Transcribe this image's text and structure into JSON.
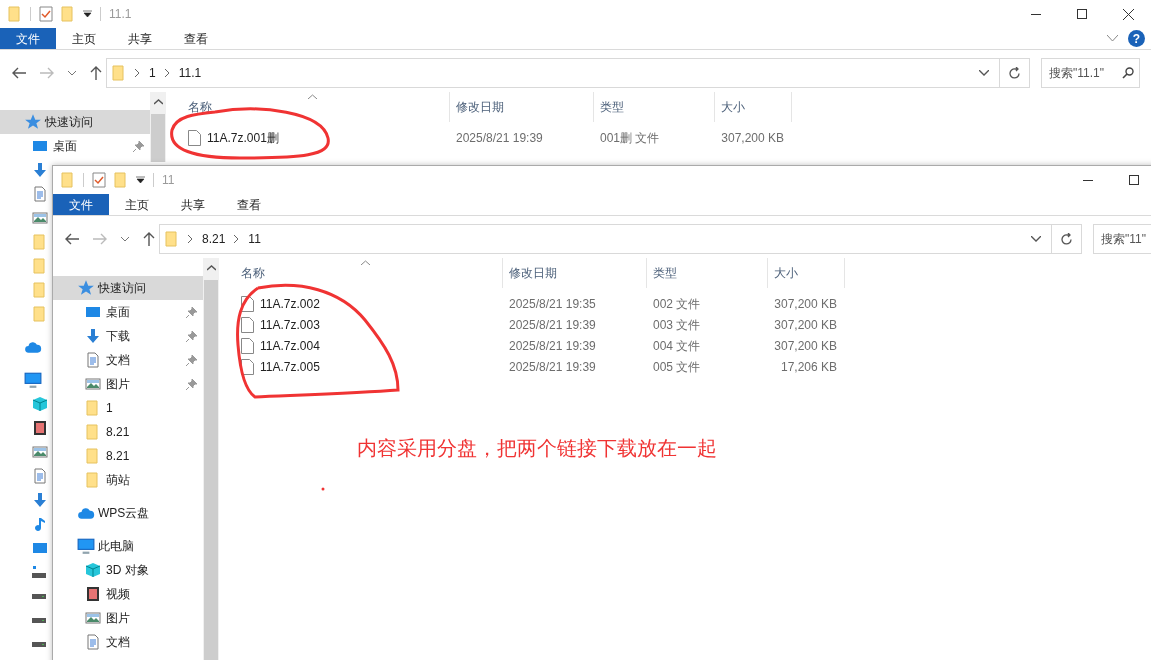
{
  "back_window": {
    "title": "11.1",
    "window_controls": [
      {
        "kind": "minimize"
      },
      {
        "kind": "maximize"
      },
      {
        "kind": "close"
      }
    ],
    "ribbon_tabs": [
      {
        "label": "文件",
        "selected": true
      },
      {
        "label": "主页",
        "selected": false
      },
      {
        "label": "共享",
        "selected": false
      },
      {
        "label": "查看",
        "selected": false
      }
    ],
    "help_button": "?",
    "path": [
      "1",
      "11.1"
    ],
    "search": {
      "placeholder": "搜索\"11.1\""
    },
    "columns": [
      "名称",
      "修改日期",
      "类型",
      "大小"
    ],
    "sidebar": [
      {
        "kind": "star",
        "label": "快速访问",
        "selected": true,
        "children": [
          {
            "kind": "desktop",
            "label": "桌面",
            "pinned": true,
            "selected": false
          },
          {
            "kind": "download",
            "selected": false
          },
          {
            "kind": "document",
            "selected": false
          },
          {
            "kind": "picture",
            "selected": false
          },
          {
            "kind": "folder",
            "selected": false
          },
          {
            "kind": "folder",
            "selected": false
          },
          {
            "kind": "folder",
            "selected": false
          },
          {
            "kind": "folder",
            "selected": false
          }
        ]
      },
      {
        "kind": "cloud",
        "selected": false
      },
      {
        "kind": "computer",
        "selected": false,
        "children": [
          {
            "kind": "cube",
            "selected": false
          },
          {
            "kind": "film",
            "selected": false
          },
          {
            "kind": "picture",
            "selected": false
          },
          {
            "kind": "document",
            "selected": false
          },
          {
            "kind": "download",
            "selected": false
          },
          {
            "kind": "music",
            "selected": false
          },
          {
            "kind": "desktop",
            "selected": false
          },
          {
            "kind": "netdrive",
            "selected": false
          },
          {
            "kind": "drive",
            "selected": false
          },
          {
            "kind": "drive",
            "selected": false
          },
          {
            "kind": "drive",
            "selected": false
          }
        ]
      }
    ],
    "files": [
      {
        "name": "11A.7z.001删",
        "modified": "2025/8/21 19:39",
        "type": "001删 文件",
        "size": "307,200 KB"
      }
    ]
  },
  "front_window": {
    "title": "11",
    "window_controls": [
      {
        "kind": "minimize"
      },
      {
        "kind": "maximize"
      }
    ],
    "ribbon_tabs": [
      {
        "label": "文件",
        "selected": true
      },
      {
        "label": "主页",
        "selected": false
      },
      {
        "label": "共享",
        "selected": false
      },
      {
        "label": "查看",
        "selected": false
      }
    ],
    "path": [
      "8.21",
      "11"
    ],
    "search": {
      "placeholder": "搜索\"11\""
    },
    "columns": [
      "名称",
      "修改日期",
      "类型",
      "大小"
    ],
    "sidebar": [
      {
        "kind": "star",
        "label": "快速访问",
        "selected": true,
        "children": [
          {
            "kind": "desktop",
            "label": "桌面",
            "pinned": true,
            "selected": false
          },
          {
            "kind": "download",
            "label": "下载",
            "pinned": true,
            "selected": false
          },
          {
            "kind": "document",
            "label": "文档",
            "pinned": true,
            "selected": false
          },
          {
            "kind": "picture",
            "label": "图片",
            "pinned": true,
            "selected": false
          },
          {
            "kind": "folder",
            "label": "1",
            "pinned": false,
            "selected": false
          },
          {
            "kind": "folder",
            "label": "8.21",
            "pinned": false,
            "selected": false
          },
          {
            "kind": "folder",
            "label": "8.21",
            "pinned": false,
            "selected": false
          },
          {
            "kind": "folder",
            "label": "萌站",
            "pinned": false,
            "selected": false
          }
        ]
      },
      {
        "kind": "cloud",
        "label": "WPS云盘",
        "selected": false
      },
      {
        "kind": "computer",
        "label": "此电脑",
        "selected": false,
        "children": [
          {
            "kind": "cube",
            "label": "3D 对象",
            "selected": false
          },
          {
            "kind": "film",
            "label": "视频",
            "selected": false
          },
          {
            "kind": "picture",
            "label": "图片",
            "selected": false
          },
          {
            "kind": "document",
            "label": "文档",
            "selected": false
          }
        ]
      }
    ],
    "files": [
      {
        "name": "11A.7z.002",
        "modified": "2025/8/21 19:35",
        "type": "002 文件",
        "size": "307,200 KB"
      },
      {
        "name": "11A.7z.003",
        "modified": "2025/8/21 19:39",
        "type": "003 文件",
        "size": "307,200 KB"
      },
      {
        "name": "11A.7z.004",
        "modified": "2025/8/21 19:39",
        "type": "004 文件",
        "size": "307,200 KB"
      },
      {
        "name": "11A.7z.005",
        "modified": "2025/8/21 19:39",
        "type": "005 文件",
        "size": "17,206 KB"
      }
    ]
  },
  "annotation": {
    "note": "内容采用分盘，把两个链接下载放在一起"
  }
}
